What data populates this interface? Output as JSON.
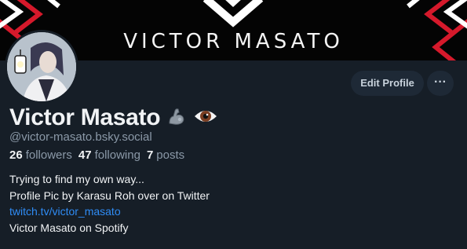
{
  "banner": {
    "title": "VICTOR MASATO"
  },
  "profile": {
    "display_name": "Victor Masato",
    "handle": "@victor-masato.bsky.social",
    "emojis": [
      "flexed-biceps-icon",
      "eye-icon"
    ]
  },
  "actions": {
    "edit_profile_label": "Edit Profile",
    "more_label": "···"
  },
  "stats": {
    "followers_count": "26",
    "followers_label": "followers",
    "following_count": "47",
    "following_label": "following",
    "posts_count": "7",
    "posts_label": "posts"
  },
  "bio": {
    "line1": "Trying to find my own way...",
    "line2": "Profile Pic by Karasu Roh over on Twitter",
    "link": "twitch.tv/victor_masato",
    "line4": "Victor Masato on Spotify"
  },
  "colors": {
    "background": "#161e27",
    "banner_bg": "#040404",
    "banner_accent": "#d5192b",
    "link": "#2f8cf5",
    "muted": "#8b99a8"
  }
}
